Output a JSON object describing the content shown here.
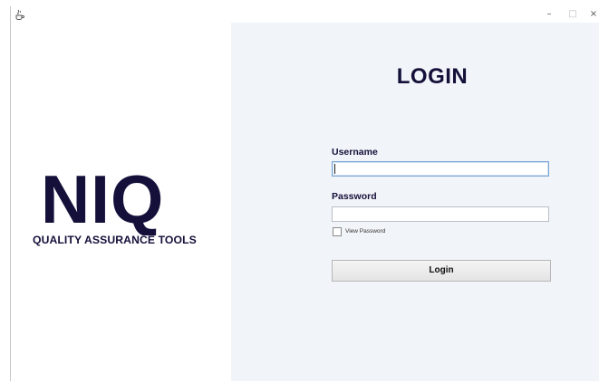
{
  "window": {
    "icon": "java-cup-icon",
    "controls": {
      "minimize": "–",
      "maximize": "□",
      "close": "×"
    }
  },
  "branding": {
    "logo_text": "NIQ",
    "tagline": "QUALITY ASSURANCE TOOLS",
    "color": "#14103a"
  },
  "login_form": {
    "heading": "LOGIN",
    "username_label": "Username",
    "username_value": "",
    "password_label": "Password",
    "password_value": "",
    "view_password_label": "View Password",
    "view_password_checked": false,
    "login_button_label": "Login"
  },
  "colors": {
    "panel_background": "#f1f4f8",
    "text_dark": "#14103a",
    "focus_border": "#7aa7d6"
  }
}
